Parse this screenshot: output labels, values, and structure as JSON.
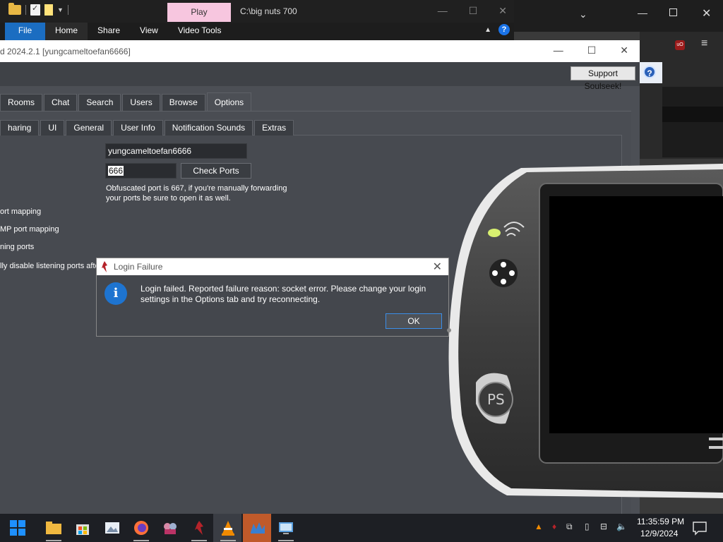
{
  "explorer": {
    "play_tab": "Play",
    "path": "C:\\big nuts 700",
    "ribbon_tabs": [
      "File",
      "Home",
      "Share",
      "View",
      "Video Tools"
    ]
  },
  "soulseek": {
    "title": "d 2024.2.1 [yungcameltoefan6666]",
    "support_button": "Support Soulseek!",
    "main_tabs": [
      "Rooms",
      "Chat",
      "Search",
      "Users",
      "Browse",
      "Options"
    ],
    "active_main_tab": "Options",
    "sub_tabs": [
      "haring",
      "UI",
      "General",
      "User Info",
      "Notification Sounds",
      "Extras"
    ],
    "username_value": "yungcameltoefan6666",
    "port_value": "666",
    "check_ports_button": "Check Ports",
    "obfuscated_note": "Obfuscated port is 667, if you're manually forwarding your ports be sure to open it as well.",
    "option_labels": [
      "ort mapping",
      "MP port mapping",
      "ning ports",
      "lly disable listening ports afte"
    ]
  },
  "dialog": {
    "title": "Login Failure",
    "message": "Login failed. Reported failure reason: socket error. Please change your login settings in the Options tab and try reconnecting.",
    "ok_button": "OK"
  },
  "taskbar": {
    "time": "11:35:59 PM",
    "date": "12/9/2024"
  },
  "colors": {
    "accent": "#1b6dc1",
    "play_tab": "#f7c6df",
    "panel": "#474a50"
  }
}
